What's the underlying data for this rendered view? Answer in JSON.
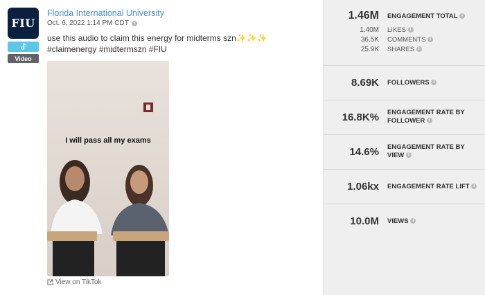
{
  "post": {
    "author": "Florida International University",
    "avatar_text": "FIU",
    "platform_icon": "tiktok-icon",
    "media_type": "Video",
    "timestamp": "Oct. 6, 2022 1:14 PM CDT",
    "caption": "use this audio to claim this energy for midterms szn✨✨✨ #claimenergy #midtermszn #FIU",
    "video_overlay_text": "I will pass all my exams",
    "view_link": "View on TikTok"
  },
  "metrics": {
    "engagement_total": {
      "value": "1.46M",
      "label": "Engagement Total"
    },
    "breakdown": [
      {
        "value": "1.40M",
        "label": "Likes"
      },
      {
        "value": "36.5K",
        "label": "Comments"
      },
      {
        "value": "25.9K",
        "label": "Shares"
      }
    ],
    "followers": {
      "value": "8.69K",
      "label": "Followers"
    },
    "engagement_rate_by_follower": {
      "value": "16.8K%",
      "label": "Engagement Rate by Follower"
    },
    "engagement_rate_by_view": {
      "value": "14.6%",
      "label": "Engagement Rate by View"
    },
    "engagement_rate_lift": {
      "value": "1.06kx",
      "label": "Engagement Rate Lift"
    },
    "views": {
      "value": "10.0M",
      "label": "Views"
    }
  },
  "colors": {
    "link": "#4a90c8",
    "tiktok_badge": "#5ec6e8",
    "avatar_bg": "#0b1f3f",
    "panel_bg": "#efefef"
  }
}
